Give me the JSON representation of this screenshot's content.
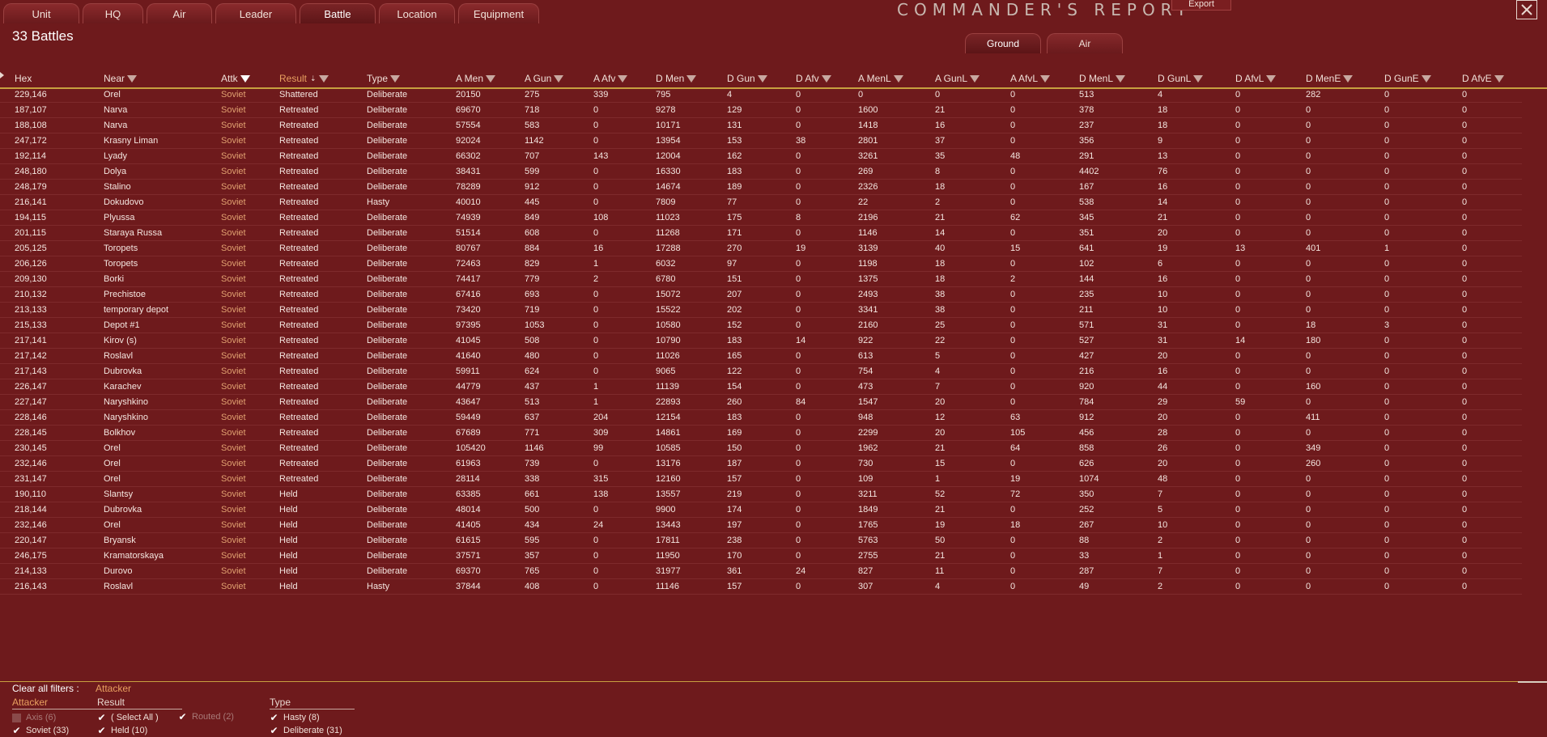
{
  "tabs": [
    {
      "label": "Unit",
      "active": false
    },
    {
      "label": "HQ",
      "active": false
    },
    {
      "label": "Air",
      "active": false
    },
    {
      "label": "Leader",
      "active": false
    },
    {
      "label": "Battle",
      "active": true
    },
    {
      "label": "Location",
      "active": false
    },
    {
      "label": "Equipment",
      "active": false
    }
  ],
  "header": {
    "title": "COMMANDER'S  REPORT",
    "export_label": "Export",
    "close_icon": "close-icon"
  },
  "battle_count": "33 Battles",
  "subtabs": [
    {
      "label": "Ground",
      "active": true
    },
    {
      "label": "Air",
      "active": false
    }
  ],
  "columns": [
    {
      "label": "Hex",
      "filter": false
    },
    {
      "label": "Near",
      "filter": true
    },
    {
      "label": "Attk",
      "filter": true,
      "active": true
    },
    {
      "label": "Result",
      "filter": true,
      "sort": true
    },
    {
      "label": "Type",
      "filter": true
    },
    {
      "label": "A Men",
      "filter": true
    },
    {
      "label": "A Gun",
      "filter": true
    },
    {
      "label": "A Afv",
      "filter": true
    },
    {
      "label": "D Men",
      "filter": true
    },
    {
      "label": "D Gun",
      "filter": true
    },
    {
      "label": "D Afv",
      "filter": true
    },
    {
      "label": "A MenL",
      "filter": true
    },
    {
      "label": "A GunL",
      "filter": true
    },
    {
      "label": "A AfvL",
      "filter": true
    },
    {
      "label": "D MenL",
      "filter": true
    },
    {
      "label": "D GunL",
      "filter": true
    },
    {
      "label": "D AfvL",
      "filter": true
    },
    {
      "label": "D MenE",
      "filter": true
    },
    {
      "label": "D GunE",
      "filter": true
    },
    {
      "label": "D AfvE",
      "filter": true
    }
  ],
  "rows": [
    [
      "229,146",
      "Orel",
      "Soviet",
      "Shattered",
      "Deliberate",
      "20150",
      "275",
      "339",
      "795",
      "4",
      "0",
      "0",
      "0",
      "0",
      "513",
      "4",
      "0",
      "282",
      "0",
      "0"
    ],
    [
      "187,107",
      "Narva",
      "Soviet",
      "Retreated",
      "Deliberate",
      "69670",
      "718",
      "0",
      "9278",
      "129",
      "0",
      "1600",
      "21",
      "0",
      "378",
      "18",
      "0",
      "0",
      "0",
      "0"
    ],
    [
      "188,108",
      "Narva",
      "Soviet",
      "Retreated",
      "Deliberate",
      "57554",
      "583",
      "0",
      "10171",
      "131",
      "0",
      "1418",
      "16",
      "0",
      "237",
      "18",
      "0",
      "0",
      "0",
      "0"
    ],
    [
      "247,172",
      "Krasny Liman",
      "Soviet",
      "Retreated",
      "Deliberate",
      "92024",
      "1142",
      "0",
      "13954",
      "153",
      "38",
      "2801",
      "37",
      "0",
      "356",
      "9",
      "0",
      "0",
      "0",
      "0"
    ],
    [
      "192,114",
      "Lyady",
      "Soviet",
      "Retreated",
      "Deliberate",
      "66302",
      "707",
      "143",
      "12004",
      "162",
      "0",
      "3261",
      "35",
      "48",
      "291",
      "13",
      "0",
      "0",
      "0",
      "0"
    ],
    [
      "248,180",
      "Dolya",
      "Soviet",
      "Retreated",
      "Deliberate",
      "38431",
      "599",
      "0",
      "16330",
      "183",
      "0",
      "269",
      "8",
      "0",
      "4402",
      "76",
      "0",
      "0",
      "0",
      "0"
    ],
    [
      "248,179",
      "Stalino",
      "Soviet",
      "Retreated",
      "Deliberate",
      "78289",
      "912",
      "0",
      "14674",
      "189",
      "0",
      "2326",
      "18",
      "0",
      "167",
      "16",
      "0",
      "0",
      "0",
      "0"
    ],
    [
      "216,141",
      "Dokudovo",
      "Soviet",
      "Retreated",
      "Hasty",
      "40010",
      "445",
      "0",
      "7809",
      "77",
      "0",
      "22",
      "2",
      "0",
      "538",
      "14",
      "0",
      "0",
      "0",
      "0"
    ],
    [
      "194,115",
      "Plyussa",
      "Soviet",
      "Retreated",
      "Deliberate",
      "74939",
      "849",
      "108",
      "11023",
      "175",
      "8",
      "2196",
      "21",
      "62",
      "345",
      "21",
      "0",
      "0",
      "0",
      "0"
    ],
    [
      "201,115",
      "Staraya Russa",
      "Soviet",
      "Retreated",
      "Deliberate",
      "51514",
      "608",
      "0",
      "11268",
      "171",
      "0",
      "1146",
      "14",
      "0",
      "351",
      "20",
      "0",
      "0",
      "0",
      "0"
    ],
    [
      "205,125",
      "Toropets",
      "Soviet",
      "Retreated",
      "Deliberate",
      "80767",
      "884",
      "16",
      "17288",
      "270",
      "19",
      "3139",
      "40",
      "15",
      "641",
      "19",
      "13",
      "401",
      "1",
      "0"
    ],
    [
      "206,126",
      "Toropets",
      "Soviet",
      "Retreated",
      "Deliberate",
      "72463",
      "829",
      "1",
      "6032",
      "97",
      "0",
      "1198",
      "18",
      "0",
      "102",
      "6",
      "0",
      "0",
      "0",
      "0"
    ],
    [
      "209,130",
      "Borki",
      "Soviet",
      "Retreated",
      "Deliberate",
      "74417",
      "779",
      "2",
      "6780",
      "151",
      "0",
      "1375",
      "18",
      "2",
      "144",
      "16",
      "0",
      "0",
      "0",
      "0"
    ],
    [
      "210,132",
      "Prechistoe",
      "Soviet",
      "Retreated",
      "Deliberate",
      "67416",
      "693",
      "0",
      "15072",
      "207",
      "0",
      "2493",
      "38",
      "0",
      "235",
      "10",
      "0",
      "0",
      "0",
      "0"
    ],
    [
      "213,133",
      "temporary depot",
      "Soviet",
      "Retreated",
      "Deliberate",
      "73420",
      "719",
      "0",
      "15522",
      "202",
      "0",
      "3341",
      "38",
      "0",
      "211",
      "10",
      "0",
      "0",
      "0",
      "0"
    ],
    [
      "215,133",
      "Depot #1",
      "Soviet",
      "Retreated",
      "Deliberate",
      "97395",
      "1053",
      "0",
      "10580",
      "152",
      "0",
      "2160",
      "25",
      "0",
      "571",
      "31",
      "0",
      "18",
      "3",
      "0"
    ],
    [
      "217,141",
      "Kirov (s)",
      "Soviet",
      "Retreated",
      "Deliberate",
      "41045",
      "508",
      "0",
      "10790",
      "183",
      "14",
      "922",
      "22",
      "0",
      "527",
      "31",
      "14",
      "180",
      "0",
      "0"
    ],
    [
      "217,142",
      "Roslavl",
      "Soviet",
      "Retreated",
      "Deliberate",
      "41640",
      "480",
      "0",
      "11026",
      "165",
      "0",
      "613",
      "5",
      "0",
      "427",
      "20",
      "0",
      "0",
      "0",
      "0"
    ],
    [
      "217,143",
      "Dubrovka",
      "Soviet",
      "Retreated",
      "Deliberate",
      "59911",
      "624",
      "0",
      "9065",
      "122",
      "0",
      "754",
      "4",
      "0",
      "216",
      "16",
      "0",
      "0",
      "0",
      "0"
    ],
    [
      "226,147",
      "Karachev",
      "Soviet",
      "Retreated",
      "Deliberate",
      "44779",
      "437",
      "1",
      "11139",
      "154",
      "0",
      "473",
      "7",
      "0",
      "920",
      "44",
      "0",
      "160",
      "0",
      "0"
    ],
    [
      "227,147",
      "Naryshkino",
      "Soviet",
      "Retreated",
      "Deliberate",
      "43647",
      "513",
      "1",
      "22893",
      "260",
      "84",
      "1547",
      "20",
      "0",
      "784",
      "29",
      "59",
      "0",
      "0",
      "0"
    ],
    [
      "228,146",
      "Naryshkino",
      "Soviet",
      "Retreated",
      "Deliberate",
      "59449",
      "637",
      "204",
      "12154",
      "183",
      "0",
      "948",
      "12",
      "63",
      "912",
      "20",
      "0",
      "411",
      "0",
      "0"
    ],
    [
      "228,145",
      "Bolkhov",
      "Soviet",
      "Retreated",
      "Deliberate",
      "67689",
      "771",
      "309",
      "14861",
      "169",
      "0",
      "2299",
      "20",
      "105",
      "456",
      "28",
      "0",
      "0",
      "0",
      "0"
    ],
    [
      "230,145",
      "Orel",
      "Soviet",
      "Retreated",
      "Deliberate",
      "105420",
      "1146",
      "99",
      "10585",
      "150",
      "0",
      "1962",
      "21",
      "64",
      "858",
      "26",
      "0",
      "349",
      "0",
      "0"
    ],
    [
      "232,146",
      "Orel",
      "Soviet",
      "Retreated",
      "Deliberate",
      "61963",
      "739",
      "0",
      "13176",
      "187",
      "0",
      "730",
      "15",
      "0",
      "626",
      "20",
      "0",
      "260",
      "0",
      "0"
    ],
    [
      "231,147",
      "Orel",
      "Soviet",
      "Retreated",
      "Deliberate",
      "28114",
      "338",
      "315",
      "12160",
      "157",
      "0",
      "109",
      "1",
      "19",
      "1074",
      "48",
      "0",
      "0",
      "0",
      "0"
    ],
    [
      "190,110",
      "Slantsy",
      "Soviet",
      "Held",
      "Deliberate",
      "63385",
      "661",
      "138",
      "13557",
      "219",
      "0",
      "3211",
      "52",
      "72",
      "350",
      "7",
      "0",
      "0",
      "0",
      "0"
    ],
    [
      "218,144",
      "Dubrovka",
      "Soviet",
      "Held",
      "Deliberate",
      "48014",
      "500",
      "0",
      "9900",
      "174",
      "0",
      "1849",
      "21",
      "0",
      "252",
      "5",
      "0",
      "0",
      "0",
      "0"
    ],
    [
      "232,146",
      "Orel",
      "Soviet",
      "Held",
      "Deliberate",
      "41405",
      "434",
      "24",
      "13443",
      "197",
      "0",
      "1765",
      "19",
      "18",
      "267",
      "10",
      "0",
      "0",
      "0",
      "0"
    ],
    [
      "220,147",
      "Bryansk",
      "Soviet",
      "Held",
      "Deliberate",
      "61615",
      "595",
      "0",
      "17811",
      "238",
      "0",
      "5763",
      "50",
      "0",
      "88",
      "2",
      "0",
      "0",
      "0",
      "0"
    ],
    [
      "246,175",
      "Kramatorskaya",
      "Soviet",
      "Held",
      "Deliberate",
      "37571",
      "357",
      "0",
      "11950",
      "170",
      "0",
      "2755",
      "21",
      "0",
      "33",
      "1",
      "0",
      "0",
      "0",
      "0"
    ],
    [
      "214,133",
      "Durovo",
      "Soviet",
      "Held",
      "Deliberate",
      "69370",
      "765",
      "0",
      "31977",
      "361",
      "24",
      "827",
      "11",
      "0",
      "287",
      "7",
      "0",
      "0",
      "0",
      "0"
    ],
    [
      "216,143",
      "Roslavl",
      "Soviet",
      "Held",
      "Hasty",
      "37844",
      "408",
      "0",
      "11146",
      "157",
      "0",
      "307",
      "4",
      "0",
      "49",
      "2",
      "0",
      "0",
      "0",
      "0"
    ]
  ],
  "filters": {
    "clear_label": "Clear all filters :",
    "active_filter": "Attacker",
    "groups": [
      {
        "title": "Attacker",
        "hot": true,
        "items": [
          {
            "label": "Axis (6)",
            "checked": false
          },
          {
            "label": "Soviet (33)",
            "checked": true
          }
        ]
      },
      {
        "title": "Result",
        "hot": false,
        "items": [
          {
            "label": "( Select All )",
            "checked": true
          },
          {
            "label": "Held  (10)",
            "checked": true
          }
        ]
      },
      {
        "title": "",
        "hot": false,
        "items": [
          {
            "label": "Routed  (2)",
            "checked": true,
            "dim": true
          }
        ]
      },
      {
        "title": "Type",
        "hot": false,
        "items": [
          {
            "label": "Hasty (8)",
            "checked": true
          },
          {
            "label": "Deliberate (31)",
            "checked": true
          }
        ]
      }
    ]
  },
  "colors": {
    "background": "#6e1a1c",
    "header_line": "#c8a040",
    "attacker_text": "#e0a070"
  }
}
